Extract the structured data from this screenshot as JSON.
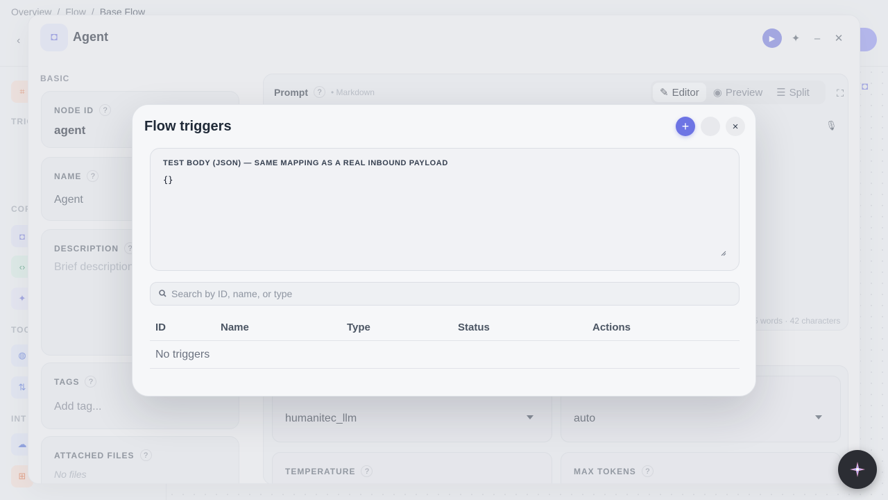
{
  "breadcrumb": {
    "items": [
      "Overview",
      "Flow",
      "Base Flow"
    ],
    "separator": "/"
  },
  "app": {
    "sidebar_labels": [
      "TRIG",
      "COR",
      "TOO",
      "INT"
    ]
  },
  "agent_panel": {
    "title": "Agent",
    "basic_label": "BASIC",
    "node_id": {
      "label": "NODE ID",
      "value": "agent"
    },
    "name": {
      "label": "NAME",
      "value": "Agent"
    },
    "description": {
      "label": "DESCRIPTION",
      "placeholder": "Brief description"
    },
    "tags": {
      "label": "TAGS",
      "placeholder": "Add tag..."
    },
    "attached_files": {
      "label": "ATTACHED FILES",
      "value": "No files"
    },
    "help_glyph": "?",
    "prompt": {
      "label": "Prompt",
      "format": "• Markdown",
      "tabs": [
        {
          "label": "Editor",
          "icon": "pencil-icon",
          "active": true
        },
        {
          "label": "Preview",
          "icon": "eye-icon",
          "active": false
        },
        {
          "label": "Split",
          "icon": "list-icon",
          "active": false
        }
      ],
      "stats": "5 words · 42 characters"
    },
    "model": {
      "value": "humanitec_llm"
    },
    "reasoning": {
      "value": "auto"
    },
    "temperature": {
      "label": "TEMPERATURE"
    },
    "max_tokens": {
      "label": "MAX TOKENS"
    }
  },
  "modal": {
    "title": "Flow triggers",
    "add_glyph": "+",
    "close_glyph": "×",
    "test_body": {
      "label": "TEST BODY (JSON) — SAME MAPPING AS A REAL INBOUND PAYLOAD",
      "value": "{}"
    },
    "search": {
      "placeholder": "Search by ID, name, or type",
      "value": ""
    },
    "table": {
      "columns": [
        "ID",
        "Name",
        "Type",
        "Status",
        "Actions"
      ],
      "rows": [],
      "empty_text": "No triggers"
    }
  },
  "colors": {
    "accent": "#6d74e4",
    "overlay": "#e1e3e9",
    "fab": "#2b2d33"
  }
}
